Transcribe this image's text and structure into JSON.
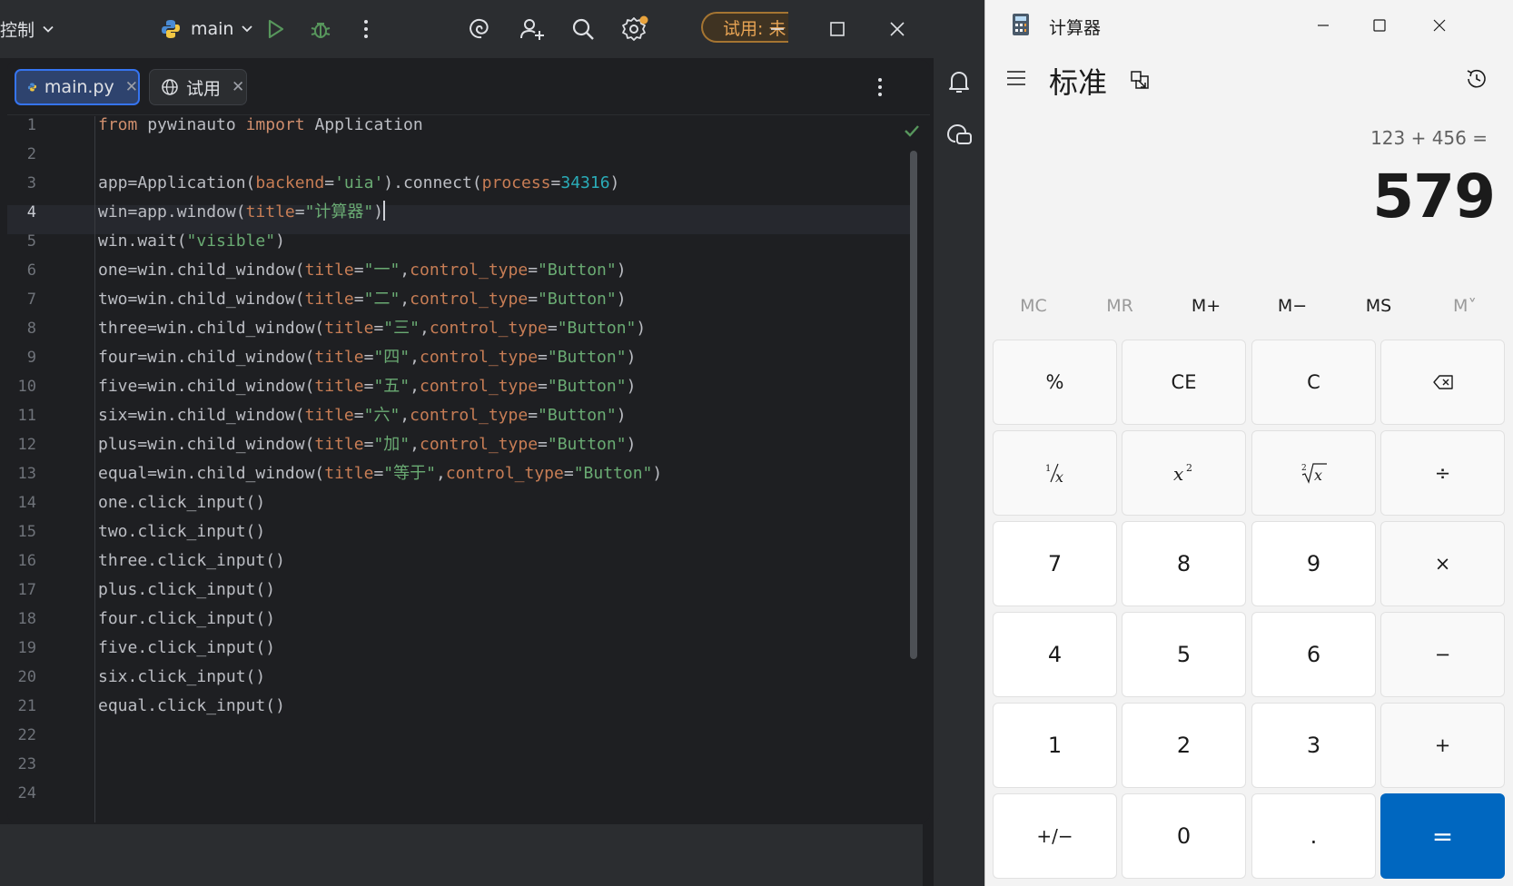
{
  "ide": {
    "toolbar": {
      "left_label": "控制",
      "branch": "main",
      "trial_badge": "试用: 未"
    },
    "tabs": [
      {
        "label": "main.py",
        "active": true
      },
      {
        "label": "试用",
        "active": false
      }
    ],
    "current_line": 4,
    "line_numbers": [
      "1",
      "2",
      "3",
      "4",
      "5",
      "6",
      "7",
      "8",
      "9",
      "10",
      "11",
      "12",
      "13",
      "14",
      "15",
      "16",
      "17",
      "18",
      "19",
      "20",
      "21",
      "22",
      "23",
      "24"
    ],
    "code": {
      "l1": {
        "a": "from",
        "b": " pywinauto ",
        "c": "import",
        "d": " Application"
      },
      "l3": {
        "a": "app=Application(",
        "b": "backend",
        "c": "=",
        "d": "'uia'",
        "e": ").connect(",
        "f": "process",
        "g": "=",
        "h": "34316",
        "i": ")"
      },
      "l4": {
        "a": "win=app.window(",
        "b": "title",
        "c": "=",
        "d": "\"计算器\"",
        "e": ")"
      },
      "l5": {
        "a": "win.wait(",
        "b": "\"visible\"",
        "c": ")"
      },
      "l6": {
        "a": "one=win.child_window(",
        "b": "title",
        "c": "=",
        "d": "\"一\"",
        "e": ",",
        "f": "control_type",
        "g": "=",
        "h": "\"Button\"",
        "i": ")"
      },
      "l7": {
        "a": "two=win.child_window(",
        "b": "title",
        "c": "=",
        "d": "\"二\"",
        "e": ",",
        "f": "control_type",
        "g": "=",
        "h": "\"Button\"",
        "i": ")"
      },
      "l8": {
        "a": "three=win.child_window(",
        "b": "title",
        "c": "=",
        "d": "\"三\"",
        "e": ",",
        "f": "control_type",
        "g": "=",
        "h": "\"Button\"",
        "i": ")"
      },
      "l9": {
        "a": "four=win.child_window(",
        "b": "title",
        "c": "=",
        "d": "\"四\"",
        "e": ",",
        "f": "control_type",
        "g": "=",
        "h": "\"Button\"",
        "i": ")"
      },
      "l10": {
        "a": "five=win.child_window(",
        "b": "title",
        "c": "=",
        "d": "\"五\"",
        "e": ",",
        "f": "control_type",
        "g": "=",
        "h": "\"Button\"",
        "i": ")"
      },
      "l11": {
        "a": "six=win.child_window(",
        "b": "title",
        "c": "=",
        "d": "\"六\"",
        "e": ",",
        "f": "control_type",
        "g": "=",
        "h": "\"Button\"",
        "i": ")"
      },
      "l12": {
        "a": "plus=win.child_window(",
        "b": "title",
        "c": "=",
        "d": "\"加\"",
        "e": ",",
        "f": "control_type",
        "g": "=",
        "h": "\"Button\"",
        "i": ")"
      },
      "l13": {
        "a": "equal=win.child_window(",
        "b": "title",
        "c": "=",
        "d": "\"等于\"",
        "e": ",",
        "f": "control_type",
        "g": "=",
        "h": "\"Button\"",
        "i": ")"
      },
      "l14": "one.click_input()",
      "l15": "two.click_input()",
      "l16": "three.click_input()",
      "l17": "plus.click_input()",
      "l18": "four.click_input()",
      "l19": "five.click_input()",
      "l20": "six.click_input()",
      "l21": "equal.click_input()"
    }
  },
  "calculator": {
    "title": "计算器",
    "mode": "标准",
    "expression": "123 + 456 =",
    "result": "579",
    "memory": [
      "MC",
      "MR",
      "M+",
      "M−",
      "MS",
      "M˅"
    ],
    "keys": {
      "percent": "%",
      "ce": "CE",
      "c": "C",
      "nine": "9",
      "eight": "8",
      "seven": "7",
      "six": "6",
      "five": "5",
      "four": "4",
      "three": "3",
      "two": "2",
      "one": "1",
      "negate": "+/−",
      "zero": "0",
      "decimal": ".",
      "divide": "÷",
      "multiply": "×",
      "minus": "−",
      "plus": "+",
      "equals": "="
    },
    "accent_color": "#0067c0"
  }
}
